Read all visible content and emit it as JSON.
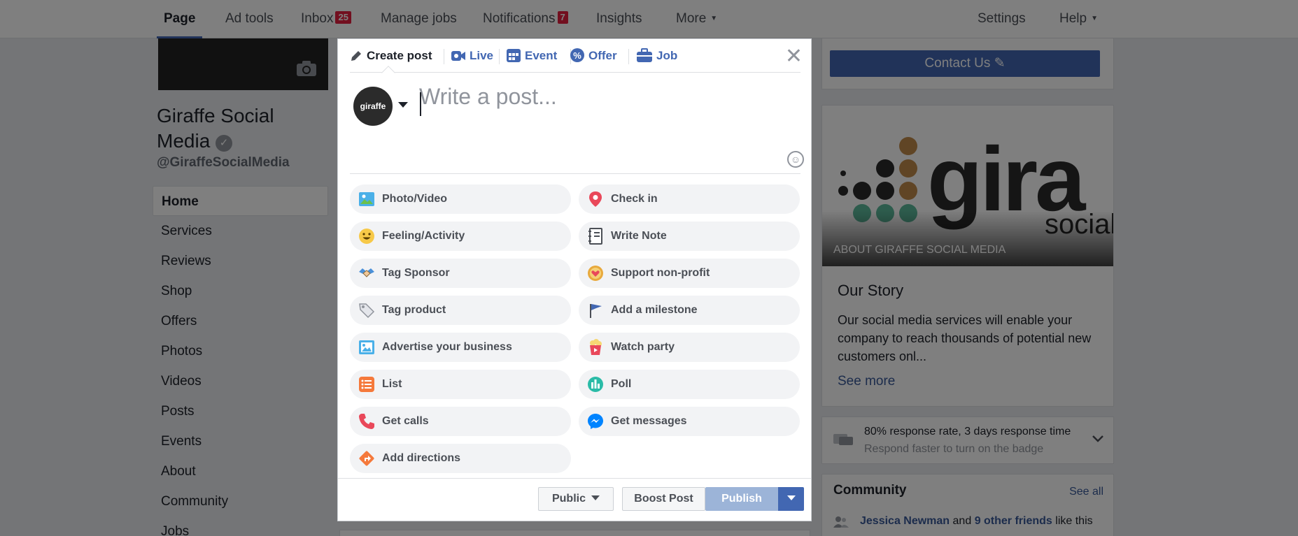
{
  "topnav": {
    "page": "Page",
    "ad_tools": "Ad tools",
    "inbox": "Inbox",
    "inbox_count": "25",
    "manage_jobs": "Manage jobs",
    "notifications": "Notifications",
    "notifications_count": "7",
    "insights": "Insights",
    "more": "More",
    "settings": "Settings",
    "help": "Help"
  },
  "profile": {
    "name": "Giraffe Social Media",
    "handle": "@GiraffeSocialMedia"
  },
  "sidebar": {
    "items": [
      "Home",
      "Services",
      "Reviews",
      "Shop",
      "Offers",
      "Photos",
      "Videos",
      "Posts",
      "Events",
      "About",
      "Community",
      "Jobs"
    ]
  },
  "right": {
    "contact_label": "Contact Us",
    "logo_text": "gira",
    "logo_subtext": "social",
    "about_label": "ABOUT GIRAFFE SOCIAL MEDIA",
    "story_title": "Our Story",
    "story_text": "Our social media services will enable your company to reach thousands of potential new customers onl...",
    "see_more": "See more",
    "response_rate": "80% response rate, 3 days response time",
    "response_hint": "Respond faster to turn on the badge",
    "community_title": "Community",
    "see_all": "See all",
    "community_name": "Jessica Newman",
    "community_and": "and",
    "community_friends": "9 other friends",
    "community_tail": "like this"
  },
  "composer": {
    "tabs": [
      "Create post",
      "Live",
      "Event",
      "Offer",
      "Job"
    ],
    "avatar_text": "giraffe",
    "placeholder": "Write a post...",
    "options": [
      "Photo/Video",
      "Check in",
      "Feeling/Activity",
      "Write Note",
      "Tag Sponsor",
      "Support non-profit",
      "Tag product",
      "Add a milestone",
      "Advertise your business",
      "Watch party",
      "List",
      "Poll",
      "Get calls",
      "Get messages",
      "Add directions"
    ],
    "public_label": "Public",
    "boost_label": "Boost Post",
    "publish_label": "Publish"
  },
  "colors": {
    "brand": "#4267b2",
    "link": "#385898",
    "badge": "#e41e3f",
    "publish_disabled": "#9cb4d8"
  }
}
